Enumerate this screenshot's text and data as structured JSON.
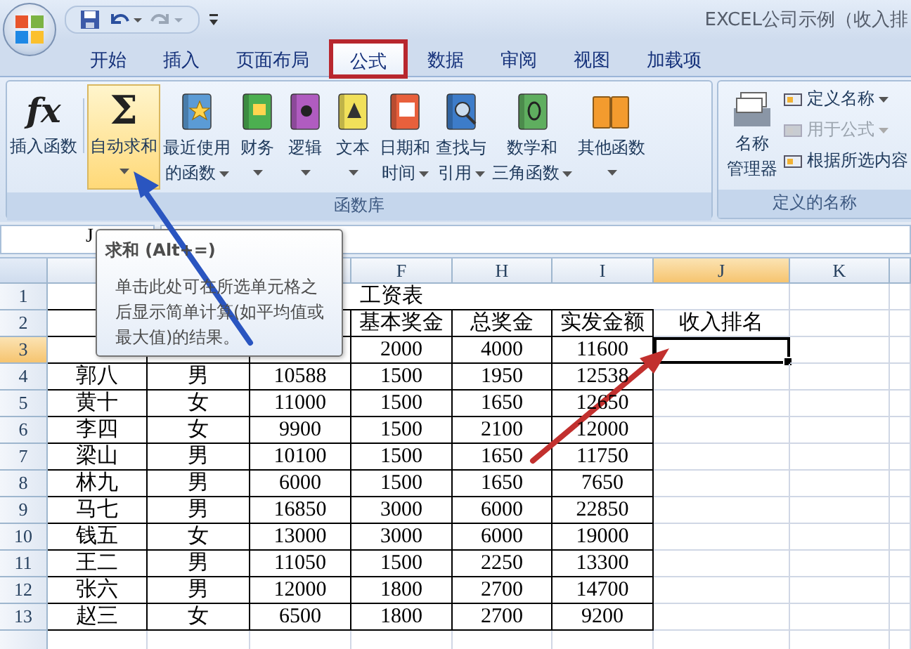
{
  "window": {
    "title": "EXCEL公司示例（收入排"
  },
  "tabs": [
    {
      "label": "开始",
      "selected": false,
      "boxed": false
    },
    {
      "label": "插入",
      "selected": false,
      "boxed": false
    },
    {
      "label": "页面布局",
      "selected": false,
      "boxed": false
    },
    {
      "label": "公式",
      "selected": true,
      "boxed": true
    },
    {
      "label": "数据",
      "selected": false,
      "boxed": false
    },
    {
      "label": "审阅",
      "selected": false,
      "boxed": false
    },
    {
      "label": "视图",
      "selected": false,
      "boxed": false
    },
    {
      "label": "加载项",
      "selected": false,
      "boxed": false
    }
  ],
  "function_library": {
    "label": "函数库",
    "items": [
      {
        "glyph": "fx",
        "lines": [
          "插入函数"
        ],
        "caret": false,
        "highlighted": false
      },
      {
        "glyph": "Σ",
        "lines": [
          "自动求和"
        ],
        "caret": true,
        "highlighted": true
      },
      {
        "lines": [
          "最近使用",
          "的函数"
        ],
        "caret": true,
        "highlighted": false
      },
      {
        "lines": [
          "财务"
        ],
        "caret": true,
        "highlighted": false
      },
      {
        "lines": [
          "逻辑"
        ],
        "caret": true,
        "highlighted": false
      },
      {
        "lines": [
          "文本"
        ],
        "caret": true,
        "highlighted": false
      },
      {
        "lines": [
          "日期和",
          "时间"
        ],
        "caret": true,
        "highlighted": false
      },
      {
        "lines": [
          "查找与",
          "引用"
        ],
        "caret": true,
        "highlighted": false
      },
      {
        "lines": [
          "数学和",
          "三角函数"
        ],
        "caret": true,
        "highlighted": false
      },
      {
        "lines": [
          "其他函数"
        ],
        "caret": true,
        "highlighted": false
      }
    ]
  },
  "defined_names": {
    "label": "定义的名称",
    "manager": [
      "名称",
      "管理器"
    ],
    "commands": [
      {
        "label": "定义名称",
        "caret": true,
        "disabled": false
      },
      {
        "label": "用于公式",
        "caret": true,
        "disabled": true
      },
      {
        "label": "根据所选内容",
        "caret": false,
        "disabled": false
      }
    ]
  },
  "name_box": "J",
  "tooltip": {
    "title": "求和 (Alt+=)",
    "body": "单击此处可在所选单元格之后显示简单计算(如平均值或最大值)的结果。"
  },
  "sheet": {
    "title_row": {
      "num": "1",
      "title": "工资表"
    },
    "columns": [
      {
        "selected": false
      },
      {},
      {
        "selected": false
      },
      {
        "label": "F",
        "selected": false
      },
      {
        "label": "H",
        "selected": false
      },
      {
        "label": "I",
        "selected": false
      },
      {
        "label": "J",
        "selected": true
      },
      {
        "label": "K",
        "selected": false
      }
    ],
    "rows": [
      {
        "num": "2",
        "selected": false,
        "cells": [
          null,
          null,
          null,
          "基本奖金",
          "总奖金",
          "实发金额",
          "收入排名",
          null
        ]
      },
      {
        "num": "3",
        "selected": true,
        "cells": [
          null,
          null,
          null,
          "2000",
          "4000",
          "11600",
          null,
          null
        ]
      },
      {
        "num": "4",
        "selected": false,
        "cells": [
          "郭八",
          "男",
          "10588",
          "1500",
          "1950",
          "12538",
          null,
          null
        ]
      },
      {
        "num": "5",
        "selected": false,
        "cells": [
          "黄十",
          "女",
          "11000",
          "1500",
          "1650",
          "12650",
          null,
          null
        ]
      },
      {
        "num": "6",
        "selected": false,
        "cells": [
          "李四",
          "女",
          "9900",
          "1500",
          "2100",
          "12000",
          null,
          null
        ]
      },
      {
        "num": "7",
        "selected": false,
        "cells": [
          "梁山",
          "男",
          "10100",
          "1500",
          "1650",
          "11750",
          null,
          null
        ]
      },
      {
        "num": "8",
        "selected": false,
        "cells": [
          "林九",
          "男",
          "6000",
          "1500",
          "1650",
          "7650",
          null,
          null
        ]
      },
      {
        "num": "9",
        "selected": false,
        "cells": [
          "马七",
          "男",
          "16850",
          "3000",
          "6000",
          "22850",
          null,
          null
        ]
      },
      {
        "num": "10",
        "selected": false,
        "cells": [
          "钱五",
          "女",
          "13000",
          "3000",
          "6000",
          "19000",
          null,
          null
        ]
      },
      {
        "num": "11",
        "selected": false,
        "cells": [
          "王二",
          "男",
          "11050",
          "1500",
          "2250",
          "13300",
          null,
          null
        ]
      },
      {
        "num": "12",
        "selected": false,
        "cells": [
          "张六",
          "男",
          "12000",
          "1800",
          "2700",
          "14700",
          null,
          null
        ]
      },
      {
        "num": "13",
        "selected": false,
        "cells": [
          "赵三",
          "女",
          "6500",
          "1800",
          "2700",
          "9200",
          null,
          null
        ]
      }
    ]
  }
}
